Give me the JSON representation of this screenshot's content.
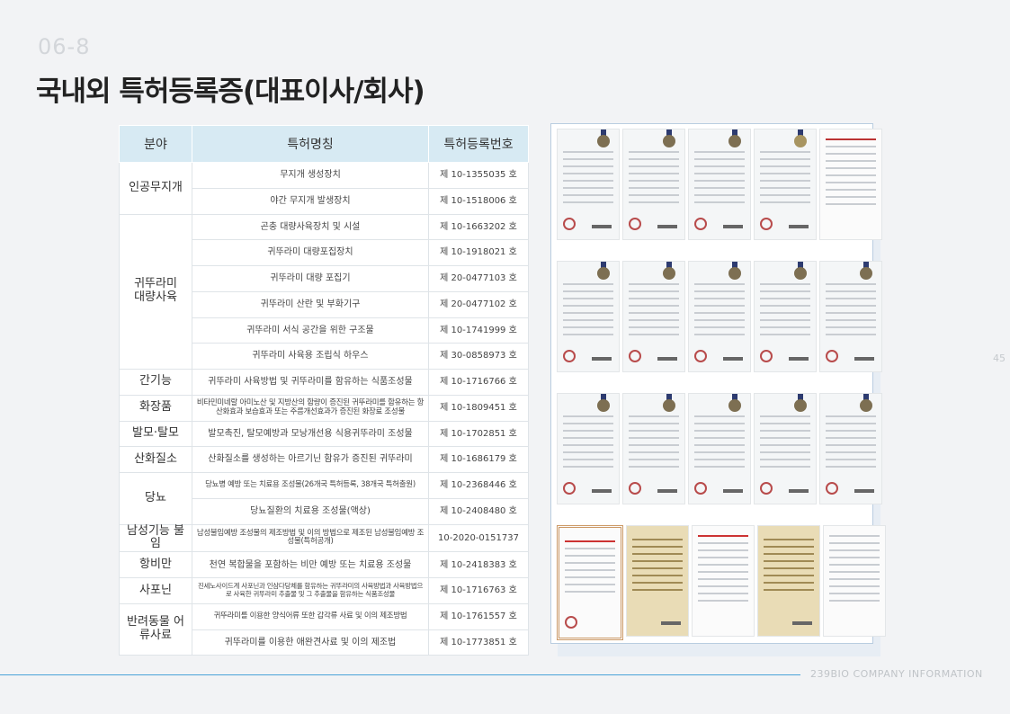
{
  "header": {
    "section_no": "06-8",
    "title": "국내외 특허등록증(대표이사/회사)"
  },
  "table": {
    "headers": [
      "분야",
      "특허명칭",
      "특허등록번호"
    ],
    "rows": [
      {
        "cat": "인공무지개",
        "name": "무지개 생성장치",
        "no": "제 10-1355035 호"
      },
      {
        "name": "야간 무지개 발생장치",
        "no": "제 10-1518006 호"
      },
      {
        "cat": "귀뚜라미 대량사육",
        "name": "곤충 대량사육장치 및 시설",
        "no": "제 10-1663202 호"
      },
      {
        "name": "귀뚜라미 대량포집장치",
        "no": "제 10-1918021 호"
      },
      {
        "name": "귀뚜라미 대량 포집기",
        "no": "제 20-0477103 호"
      },
      {
        "name": "귀뚜라미 산란 및 부화기구",
        "no": "제 20-0477102 호"
      },
      {
        "name": "귀뚜라미 서식 공간을 위한 구조물",
        "no": "제 10-1741999 호"
      },
      {
        "name": "귀뚜라미 사육용 조립식 하우스",
        "no": "제 30-0858973 호"
      },
      {
        "cat": "간기능",
        "name": "귀뚜라미 사육방법 및 귀뚜라미를 함유하는 식품조성물",
        "no": "제 10-1716766 호"
      },
      {
        "cat": "화장품",
        "name": "비타민미네랄 아미노산 및 지방산의 함량이 증진된 귀뚜라미를 함유하는 항산화효과 보습효과 또는 주름개선효과가 증진된 화장료 조성물",
        "no": "제 10-1809451 호"
      },
      {
        "cat": "발모·탈모",
        "name": "발모촉진, 탈모예방과 모낭개선용 식용귀뚜라미 조성물",
        "no": "제 10-1702851 호"
      },
      {
        "cat": "산화질소",
        "name": "산화질소를 생성하는 아르기닌 함유가 증진된 귀뚜라미",
        "no": "제 10-1686179 호"
      },
      {
        "cat": "당뇨",
        "name": "당뇨병 예방 또는 치료용 조성물(26개국 특허등록, 38개국 특허출원)",
        "no": "제 10-2368446 호"
      },
      {
        "name": "당뇨질환의 치료용 조성물(액상)",
        "no": "제 10-2408480 호"
      },
      {
        "cat": "남성기능 불임",
        "name": "남성불임예방 조성물의 제조방법 및 이의 방법으로 제조된 남성불임예방 조성물(특허공개)",
        "no": "10-2020-0151737"
      },
      {
        "cat": "항비만",
        "name": "천연 복합물을 포함하는 비만 예방 또는 치료용 조성물",
        "no": "제 10-2418383 호"
      },
      {
        "cat": "사포닌",
        "name": "진세노사이드계 사포닌과 인삼다당체를 함유하는 귀뚜라미의 사육방법과 사육방법으로 사육한 귀뚜라미 추출물 및 그 추출물을 함유하는 식품조성물",
        "no": "제 10-1716763 호"
      },
      {
        "cat": "반려동물 어류사료",
        "name": "귀뚜라미를 이용한 양식어류 또한 갑각류 사료 및 이의 제조방법",
        "no": "제 10-1761557 호"
      },
      {
        "name": "귀뚜라미를 이용한 애완견사료 및 이의 제조법",
        "no": "제 10-1773851 호"
      }
    ]
  },
  "page_number": "45",
  "footer": {
    "company": "239BIO COMPANY INFORMATION"
  }
}
